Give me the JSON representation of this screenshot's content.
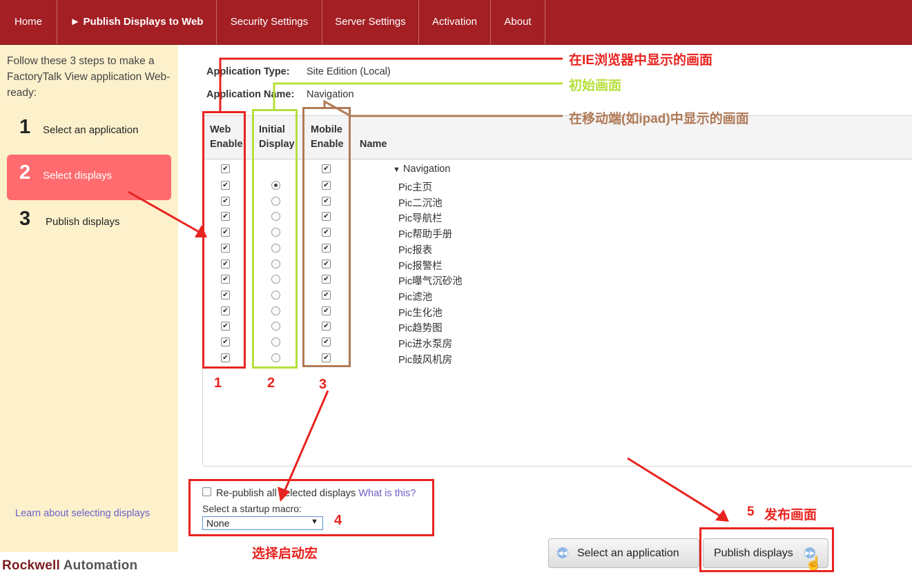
{
  "nav": {
    "items": [
      "Home",
      "► Publish Displays to Web",
      "Security Settings",
      "Server Settings",
      "Activation",
      "About"
    ]
  },
  "sidebar": {
    "intro": "Follow these 3 steps to make a FactoryTalk View application Web-ready:",
    "steps": [
      {
        "num": "1",
        "label": "Select an application"
      },
      {
        "num": "2",
        "label": "Select displays"
      },
      {
        "num": "3",
        "label": "Publish displays"
      }
    ],
    "learn_link": "Learn about selecting displays",
    "logo_primary": "Rockwell",
    "logo_secondary": "Automation"
  },
  "app": {
    "type_label": "Application Type:",
    "type_value": "Site Edition (Local)",
    "name_label": "Application Name:",
    "name_value": "Navigation"
  },
  "table": {
    "headers": {
      "web_enable": "Web Enable",
      "initial_display": "Initial Display",
      "mobile_enable": "Mobile Enable",
      "name": "Name"
    },
    "group": "Navigation",
    "rows": [
      {
        "name": "Pic主页",
        "initial": true
      },
      {
        "name": "Pic二沉池",
        "initial": false
      },
      {
        "name": "Pic导航栏",
        "initial": false
      },
      {
        "name": "Pic帮助手册",
        "initial": false
      },
      {
        "name": "Pic报表",
        "initial": false
      },
      {
        "name": "Pic报警栏",
        "initial": false
      },
      {
        "name": "Pic曝气沉砂池",
        "initial": false
      },
      {
        "name": "Pic滤池",
        "initial": false
      },
      {
        "name": "Pic生化池",
        "initial": false
      },
      {
        "name": "Pic趋势图",
        "initial": false
      },
      {
        "name": "Pic进水泵房",
        "initial": false
      },
      {
        "name": "Pic鼓风机房",
        "initial": false
      }
    ]
  },
  "options": {
    "republish_label": "Re-publish all selected displays",
    "what_link": "What is this?",
    "macro_label": "Select a startup macro:",
    "macro_value": "None"
  },
  "buttons": {
    "back": "Select an application",
    "publish": "Publish displays"
  },
  "annotations": {
    "ie_display": "在IE浏览器中显示的画面",
    "initial_display": "初始画面",
    "mobile_display": "在移动端(如ipad)中显示的画面",
    "n1": "1",
    "n2": "2",
    "n3": "3",
    "n4": "4",
    "startup_macro": "选择启动宏",
    "n5": "5",
    "publish": "发布画面"
  },
  "colors": {
    "nav": "#a31f24",
    "sidebar": "#fdf1cc",
    "active_step": "#ff6b6e",
    "annot_red": "#e8231f",
    "annot_green": "#b5e03a",
    "annot_brown": "#b07a57"
  }
}
